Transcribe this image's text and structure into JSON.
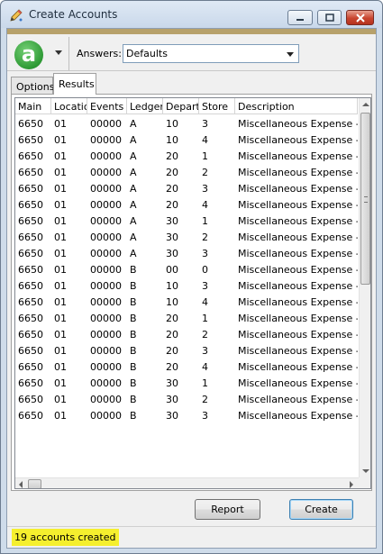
{
  "window": {
    "title": "Create Accounts"
  },
  "toolbar": {
    "logo_text": "a",
    "answers_label": "Answers:",
    "answers_value": "Defaults"
  },
  "tabs": [
    {
      "label": "Options",
      "selected": false
    },
    {
      "label": "Results",
      "selected": true
    }
  ],
  "grid": {
    "columns": [
      "Main",
      "Location",
      "Events",
      "Ledger",
      "Department",
      "Store",
      "Description"
    ],
    "rows": [
      [
        "6650",
        "01",
        "00000",
        "A",
        "10",
        "3",
        "Miscellaneous Expense - Fu"
      ],
      [
        "6650",
        "01",
        "00000",
        "A",
        "10",
        "4",
        "Miscellaneous Expense - Fu"
      ],
      [
        "6650",
        "01",
        "00000",
        "A",
        "20",
        "1",
        "Miscellaneous Expense - Su"
      ],
      [
        "6650",
        "01",
        "00000",
        "A",
        "20",
        "2",
        "Miscellaneous Expense - Su"
      ],
      [
        "6650",
        "01",
        "00000",
        "A",
        "20",
        "3",
        "Miscellaneous Expense - Su"
      ],
      [
        "6650",
        "01",
        "00000",
        "A",
        "20",
        "4",
        "Miscellaneous Expense - Su"
      ],
      [
        "6650",
        "01",
        "00000",
        "A",
        "30",
        "1",
        "Miscellaneous Expense - Eq"
      ],
      [
        "6650",
        "01",
        "00000",
        "A",
        "30",
        "2",
        "Miscellaneous Expense - Eq"
      ],
      [
        "6650",
        "01",
        "00000",
        "A",
        "30",
        "3",
        "Miscellaneous Expense - Eq"
      ],
      [
        "6650",
        "01",
        "00000",
        "B",
        "00",
        "0",
        "Miscellaneous Expense - Ad"
      ],
      [
        "6650",
        "01",
        "00000",
        "B",
        "10",
        "3",
        "Miscellaneous Expense - Fu"
      ],
      [
        "6650",
        "01",
        "00000",
        "B",
        "10",
        "4",
        "Miscellaneous Expense - Fu"
      ],
      [
        "6650",
        "01",
        "00000",
        "B",
        "20",
        "1",
        "Miscellaneous Expense - Su"
      ],
      [
        "6650",
        "01",
        "00000",
        "B",
        "20",
        "2",
        "Miscellaneous Expense - Su"
      ],
      [
        "6650",
        "01",
        "00000",
        "B",
        "20",
        "3",
        "Miscellaneous Expense - Su"
      ],
      [
        "6650",
        "01",
        "00000",
        "B",
        "20",
        "4",
        "Miscellaneous Expense - Su"
      ],
      [
        "6650",
        "01",
        "00000",
        "B",
        "30",
        "1",
        "Miscellaneous Expense - Eq"
      ],
      [
        "6650",
        "01",
        "00000",
        "B",
        "30",
        "2",
        "Miscellaneous Expense - Eq"
      ],
      [
        "6650",
        "01",
        "00000",
        "B",
        "30",
        "3",
        "Miscellaneous Expense - Eq"
      ]
    ]
  },
  "buttons": {
    "report": "Report",
    "create": "Create"
  },
  "status": {
    "text": "19 accounts created",
    "highlight": "#f5ef2e"
  },
  "colors": {
    "accent_bar": "#b7a16b",
    "logo_green": "#2e9a35"
  }
}
